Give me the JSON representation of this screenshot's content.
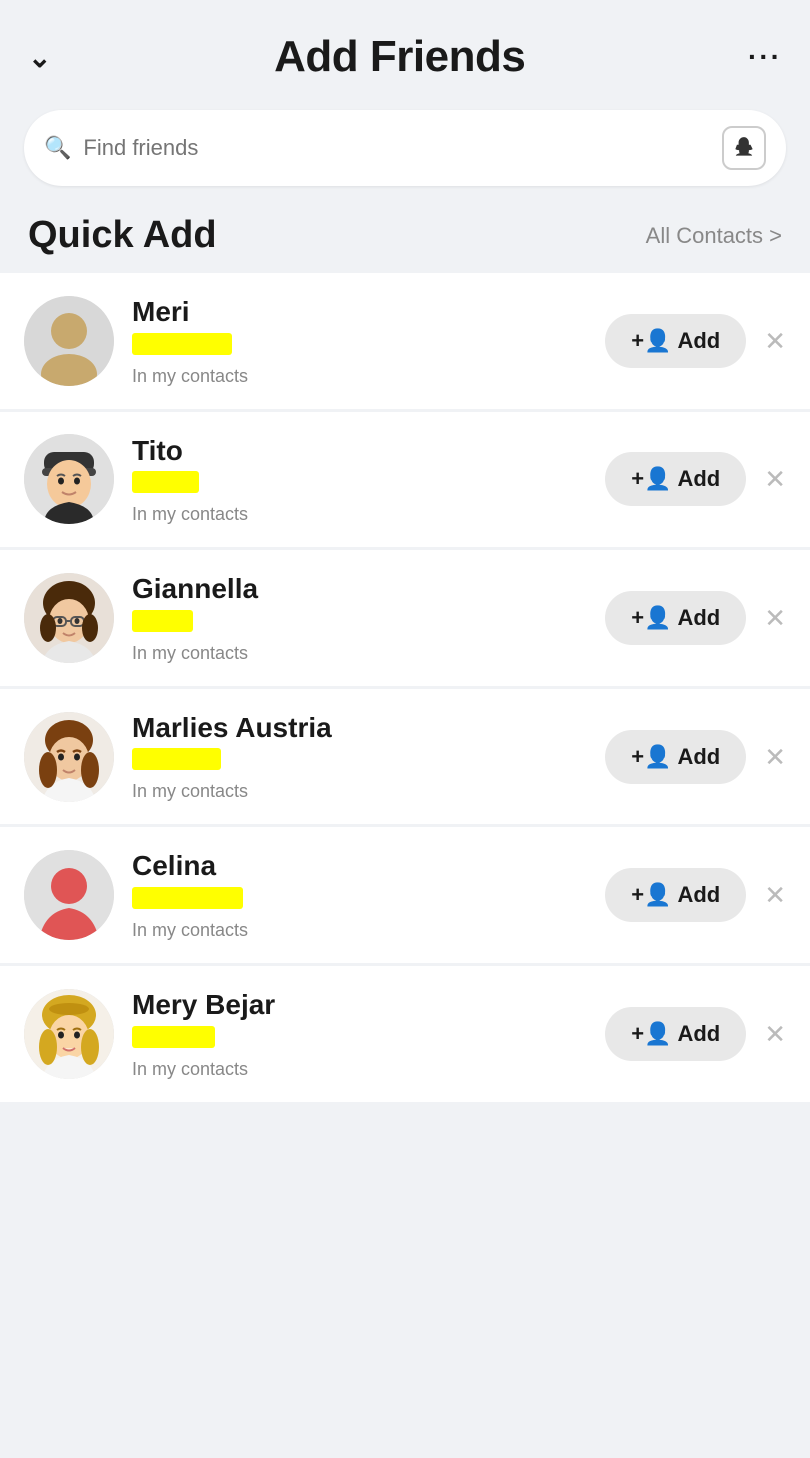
{
  "header": {
    "back_icon": "chevron-down",
    "title": "Add Friends",
    "more_icon": "ellipsis"
  },
  "search": {
    "placeholder": "Find friends",
    "snapcode_icon": "snapcode-icon"
  },
  "quick_add": {
    "section_title": "Quick Add",
    "all_contacts_label": "All Contacts >"
  },
  "contacts": [
    {
      "id": 1,
      "name": "Meri",
      "username_redacted": true,
      "sub": "In my contacts",
      "add_label": "+ Add",
      "avatar_type": "default_tan"
    },
    {
      "id": 2,
      "name": "Tito",
      "username_redacted": true,
      "sub": "In my contacts",
      "add_label": "+ Add",
      "avatar_type": "bitmoji_beanie"
    },
    {
      "id": 3,
      "name": "Giannella",
      "username_redacted": true,
      "sub": "In my contacts",
      "add_label": "+ Add",
      "avatar_type": "bitmoji_girl_glasses"
    },
    {
      "id": 4,
      "name": "Marlies Austria",
      "username_redacted": true,
      "sub": "In my contacts",
      "add_label": "+ Add",
      "avatar_type": "bitmoji_girl_brown"
    },
    {
      "id": 5,
      "name": "Celina",
      "username_redacted": true,
      "sub": "In my contacts",
      "add_label": "+ Add",
      "avatar_type": "default_red"
    },
    {
      "id": 6,
      "name": "Mery Bejar",
      "username_redacted": true,
      "sub": "In my contacts",
      "add_label": "+ Add",
      "avatar_type": "bitmoji_blonde"
    }
  ],
  "colors": {
    "background": "#f0f2f5",
    "card_bg": "#ffffff",
    "username_highlight": "#FFFF00",
    "add_btn_bg": "#e8e8e8",
    "text_primary": "#1a1a1a",
    "text_secondary": "#888888"
  }
}
